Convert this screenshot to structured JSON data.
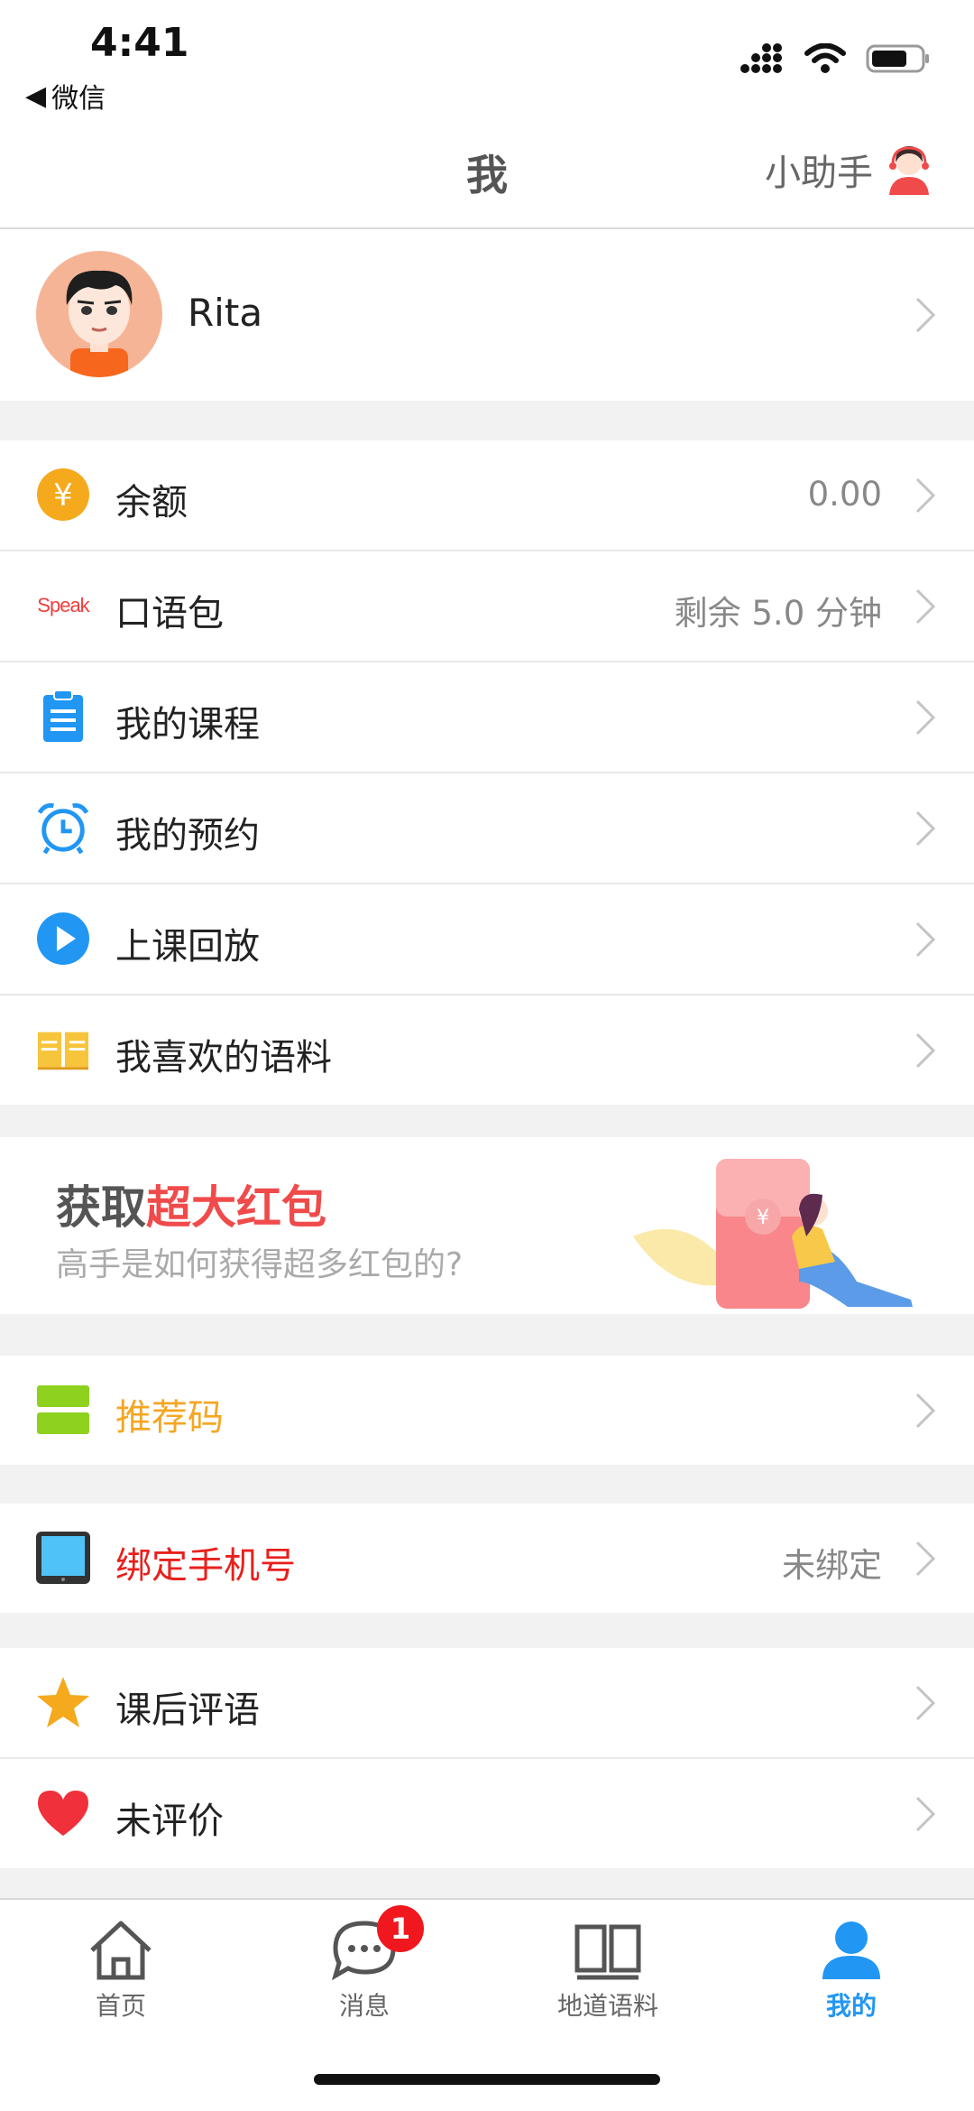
{
  "status_bar": {
    "time": "4:41",
    "back_app": "微信"
  },
  "nav": {
    "title": "我",
    "assistant_label": "小助手"
  },
  "profile": {
    "name": "Rita"
  },
  "account": {
    "items": [
      {
        "label": "余额",
        "value": "0.00",
        "icon": "yuan-icon"
      },
      {
        "label": "口语包",
        "value": "剩余 5.0 分钟",
        "icon": "speak-logo-icon",
        "icon_text": "Speak"
      },
      {
        "label": "我的课程",
        "value": "",
        "icon": "clipboard-icon"
      },
      {
        "label": "我的预约",
        "value": "",
        "icon": "alarm-clock-icon"
      },
      {
        "label": "上课回放",
        "value": "",
        "icon": "play-icon"
      },
      {
        "label": "我喜欢的语料",
        "value": "",
        "icon": "open-book-icon"
      }
    ]
  },
  "banner": {
    "headline_prefix": "获取",
    "headline_highlight": "超大红包",
    "subtitle": "高手是如何获得超多红包的?",
    "art_symbol": "¥"
  },
  "referral": {
    "label": "推荐码",
    "color": "#f5a623"
  },
  "phone": {
    "label": "绑定手机号",
    "value": "未绑定",
    "color": "#e8201c"
  },
  "reviews": {
    "items": [
      {
        "label": "课后评语"
      },
      {
        "label": "未评价"
      }
    ]
  },
  "tabs": [
    {
      "label": "首页",
      "icon": "home-icon"
    },
    {
      "label": "消息",
      "icon": "chat-icon",
      "badge": "1"
    },
    {
      "label": "地道语料",
      "icon": "book-icon"
    },
    {
      "label": "我的",
      "icon": "user-icon",
      "active": true
    }
  ],
  "colors": {
    "accent": "#2196f3",
    "badge": "#f0181e",
    "highlight": "#f04a4a"
  }
}
